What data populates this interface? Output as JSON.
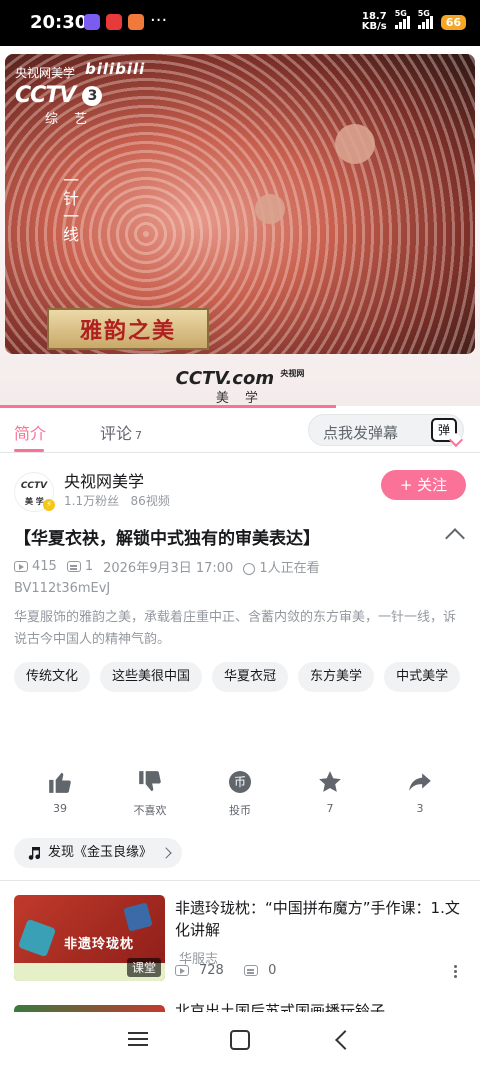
{
  "status_bar": {
    "time": "20:30",
    "net_speed": "18.7",
    "net_unit": "KB/s",
    "signal1": "5G",
    "signal2": "5G",
    "battery": "66",
    "more": "···"
  },
  "video": {
    "watermark_channel": "央视网美学",
    "watermark_bili": "bilibili",
    "cctv_logo": "CCTV",
    "cctv_channel_num": "3",
    "cctv_channel_name": "综 艺",
    "overlay_vertical_text": "一针一线",
    "overlay_plaque": "雅韵之美",
    "footer_logo": "CCTV.com",
    "footer_logo_tag": "央视网",
    "footer_sub": "美 学",
    "progress_fraction": 0.7
  },
  "tabs": {
    "intro": "简介",
    "comments": "评论",
    "comments_count": "7",
    "danmu_placeholder": "点我发弹幕",
    "danmu_button": "弹"
  },
  "uploader": {
    "name": "央视网美学",
    "fans": "1.1万粉丝",
    "videos": "86视频",
    "follow": "+ 关注",
    "avatar_text": "CCTV",
    "avatar_sub": "美 学"
  },
  "video_info": {
    "title": "【华夏衣袂，解锁中式独有的审美表达】",
    "views": "415",
    "danmaku": "1",
    "date": "2026年9月3日 17:00",
    "watching": "1人正在看",
    "bvid": "BV112t36mEvJ",
    "description": "华夏服饰的雅韵之美，承载着庄重中正、含蓄内敛的东方审美，一针一线，诉说古今中国人的精神气韵。",
    "tags": [
      "传统文化",
      "这些美很中国",
      "华夏衣冠",
      "东方美学",
      "中式美学"
    ]
  },
  "actions": {
    "like": {
      "label": "39",
      "icon": "thumb-up-icon"
    },
    "dislike": {
      "label": "不喜欢",
      "icon": "thumb-down-icon"
    },
    "coin": {
      "label": "投币",
      "icon": "coin-icon",
      "glyph": "币"
    },
    "favorite": {
      "label": "7",
      "icon": "star-icon"
    },
    "share": {
      "label": "3",
      "icon": "share-icon"
    }
  },
  "music": {
    "label": "发现《金玉良缘》"
  },
  "recommendations": [
    {
      "title": "非遗玲珑枕：“中国拼布魔方”手作课：1.文化讲解",
      "author": "华服志",
      "views": "728",
      "danmaku": "0",
      "badge": "课堂",
      "thumb_text": "非遗玲珑枕"
    },
    {
      "title": "北京出土国后苏式国画播玩铃子"
    }
  ],
  "colors": {
    "accent": "#fb7299",
    "text": "#18191c",
    "muted": "#9499a0"
  }
}
